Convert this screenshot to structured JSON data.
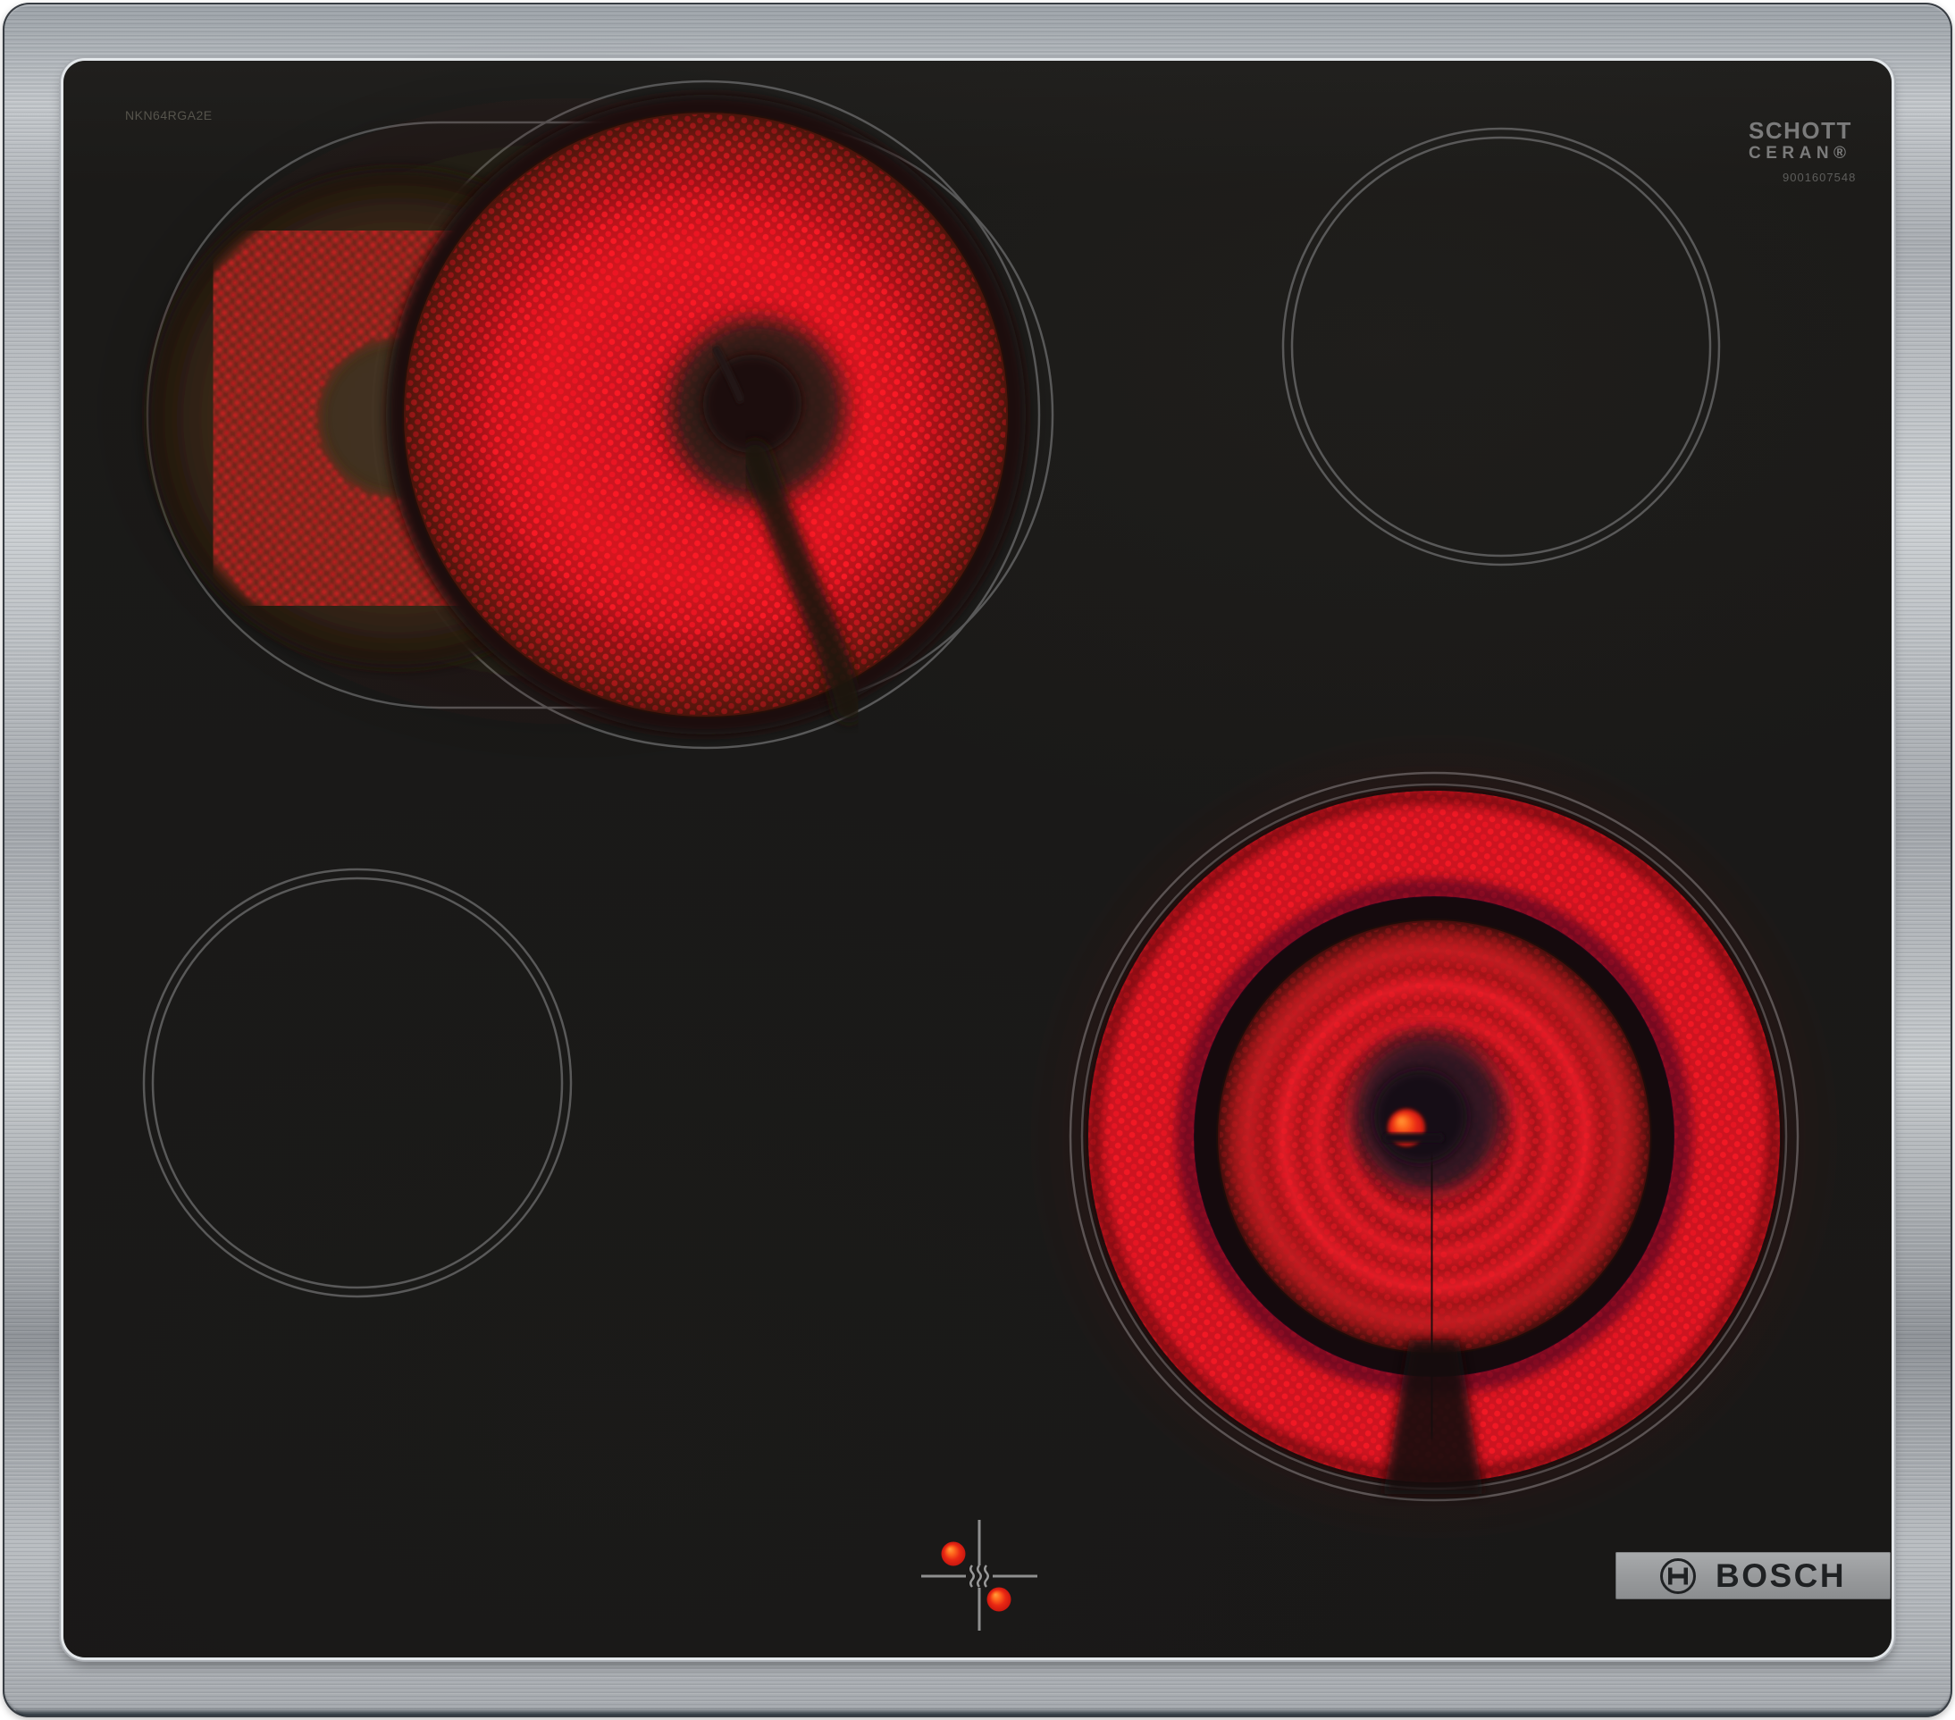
{
  "product": {
    "model_label": "NKN64RGA2E",
    "glass_brand_line1": "SCHOTT",
    "glass_brand_line2": "CERAN®",
    "serial_number": "9001607548",
    "brand_logo_text": "BOSCH"
  },
  "appliance": {
    "type": "electric ceramic hob, 4 zones",
    "zones": [
      {
        "id": "rear-left",
        "kind": "dual extendable radiant zone",
        "state": "on, element glowing red"
      },
      {
        "id": "rear-right",
        "kind": "single radiant zone",
        "state": "off"
      },
      {
        "id": "front-left",
        "kind": "single radiant zone",
        "state": "off"
      },
      {
        "id": "front-right",
        "kind": "large radiant zone",
        "state": "on, element glowing red"
      }
    ],
    "residual_heat_indicator": {
      "symbol": "heat waves cross",
      "lit_dots": 2
    }
  },
  "colors": {
    "frame_steel": "#b5b9bd",
    "glass_black": "#1b1a18",
    "zone_outline": "#5f5f5f",
    "glow_red": "#d81523",
    "glow_dot_red": "#ff1a26",
    "halo_brown": "#6b3c1e",
    "indicator_dot_orange": "#f4581c",
    "badge_gray": "#97999b"
  }
}
